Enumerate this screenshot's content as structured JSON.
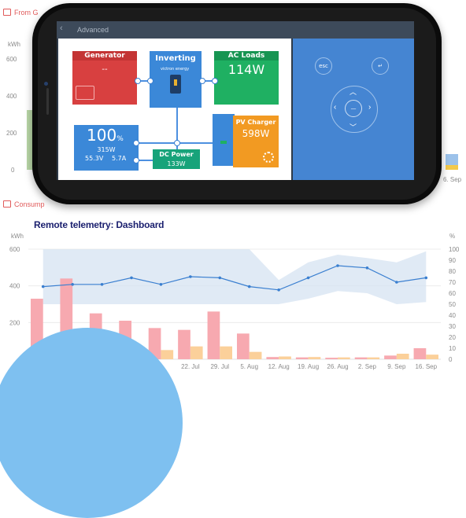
{
  "colors": {
    "accent": "#e05a5a",
    "tile_red": "#d84040",
    "tile_blue": "#3b88d8",
    "tile_green": "#1fb062",
    "tile_orange": "#f29a22",
    "tile_teal": "#17a37a",
    "remote_blue": "#4585d2",
    "caption_navy": "#1a1f6e"
  },
  "background_panel": {
    "section_title": "From G",
    "unit": "kWh",
    "y_ticks": [
      "600",
      "400",
      "200",
      "0"
    ],
    "end_label": "6. Sep"
  },
  "phone": {
    "header_title": "Advanced",
    "tiles": {
      "generator": {
        "title": "Generator",
        "value": "--"
      },
      "inverter": {
        "title": "Inverting",
        "brand": "victron energy"
      },
      "ac_loads": {
        "title": "AC Loads",
        "value": "114W"
      },
      "battery": {
        "percent": "100",
        "percent_unit": "%",
        "power": "315W",
        "voltage": "55.3V",
        "current": "5.7A"
      },
      "dc_power": {
        "title": "DC Power",
        "value": "133W"
      },
      "pv_charger": {
        "title": "PV Charger",
        "value": "598W"
      }
    },
    "remote": {
      "esc_label": "esc",
      "enter_label": "↵",
      "center_label": "—"
    }
  },
  "caption": "Remote telemetry: Dashboard",
  "consumption_section": {
    "title": "Consump"
  },
  "chart_data": {
    "type": "bar",
    "title": "",
    "ylabel": "kWh",
    "y2label": "%",
    "ylim": [
      0,
      600
    ],
    "y2lim": [
      0,
      100
    ],
    "y_ticks": [
      "600",
      "400",
      "200"
    ],
    "y2_ticks": [
      "100",
      "90",
      "80",
      "70",
      "60",
      "50",
      "40",
      "30",
      "20",
      "10",
      "0"
    ],
    "categories": [
      "",
      "",
      "",
      "",
      "",
      "22. Jul",
      "29. Jul",
      "5. Aug",
      "12. Aug",
      "19. Aug",
      "26. Aug",
      "2. Sep",
      "9. Sep",
      "16. Sep"
    ],
    "series": [
      {
        "kind": "bar",
        "color": "#f7a9b0",
        "values": [
          330,
          440,
          250,
          210,
          170,
          160,
          260,
          140,
          12,
          10,
          8,
          10,
          20,
          60
        ]
      },
      {
        "kind": "bar",
        "color": "#fbd09a",
        "values": [
          40,
          80,
          70,
          60,
          50,
          70,
          70,
          40,
          15,
          12,
          10,
          10,
          30,
          25
        ]
      },
      {
        "kind": "line",
        "axis": "right",
        "color": "#3a7fd0",
        "values": [
          66,
          68,
          68,
          74,
          68,
          75,
          74,
          66,
          63,
          74,
          85,
          83,
          70,
          74
        ]
      },
      {
        "kind": "band",
        "axis": "right",
        "lower": [
          50,
          50,
          50,
          50,
          50,
          50,
          50,
          50,
          50,
          55,
          62,
          60,
          50,
          52
        ],
        "upper": [
          100,
          100,
          100,
          100,
          100,
          100,
          100,
          100,
          72,
          88,
          95,
          92,
          88,
          98
        ]
      }
    ]
  }
}
